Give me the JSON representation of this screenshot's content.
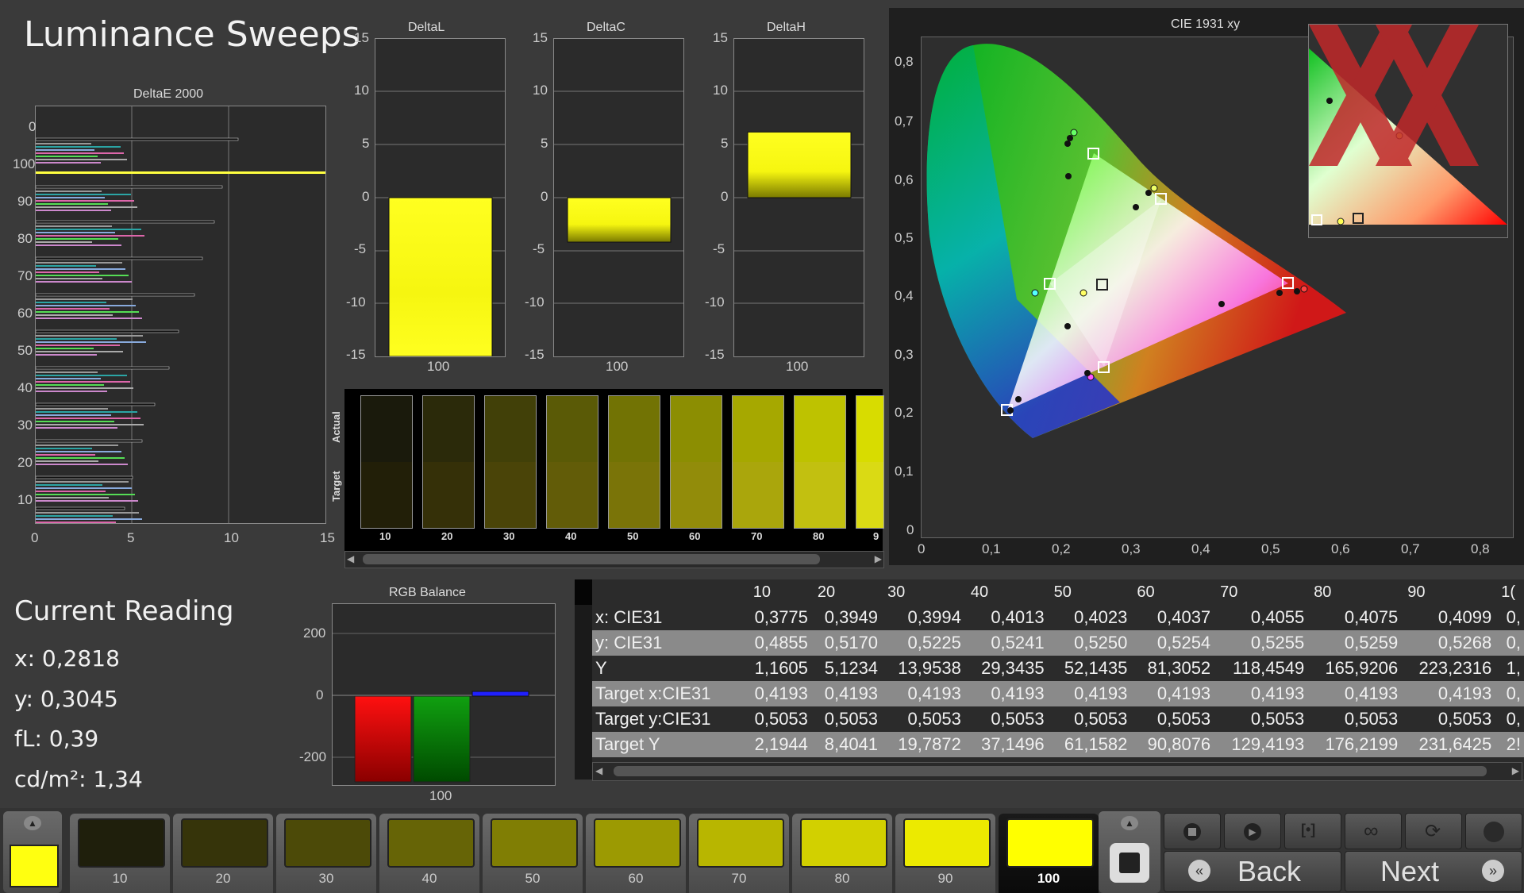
{
  "title": "Luminance Sweeps",
  "deltaE": {
    "title": "DeltaE 2000",
    "y_ticks": [
      "0",
      "100",
      "90",
      "80",
      "70",
      "60",
      "50",
      "40",
      "30",
      "20",
      "10"
    ],
    "x_ticks": [
      "0",
      "5",
      "10",
      "15"
    ]
  },
  "delta_charts": [
    {
      "title": "DeltaL",
      "xlabel": "100"
    },
    {
      "title": "DeltaC",
      "xlabel": "100"
    },
    {
      "title": "DeltaH",
      "xlabel": "100"
    }
  ],
  "delta_y_ticks": [
    "15",
    "10",
    "5",
    "0",
    "-5",
    "-10",
    "-15"
  ],
  "strip": {
    "actual_label": "Actual",
    "target_label": "Target",
    "steps": [
      {
        "label": "10",
        "actual": "#1a1a0c",
        "target": "#221f08"
      },
      {
        "label": "20",
        "actual": "#2b2a0a",
        "target": "#353008"
      },
      {
        "label": "30",
        "actual": "#414008",
        "target": "#4a4408"
      },
      {
        "label": "40",
        "actual": "#5a5a06",
        "target": "#625c08"
      },
      {
        "label": "50",
        "actual": "#727304",
        "target": "#7a7408"
      },
      {
        "label": "60",
        "actual": "#8c8e02",
        "target": "#928c0a"
      },
      {
        "label": "70",
        "actual": "#a6a800",
        "target": "#aaa60c"
      },
      {
        "label": "80",
        "actual": "#bec200",
        "target": "#c2c010"
      },
      {
        "label": "9",
        "actual": "#d8dc00",
        "target": "#dada14"
      }
    ]
  },
  "cie": {
    "title": "CIE 1931 xy",
    "x_ticks": [
      "0",
      "0,1",
      "0,2",
      "0,3",
      "0,4",
      "0,5",
      "0,6",
      "0,7",
      "0,8"
    ],
    "y_ticks": [
      "0,8",
      "0,7",
      "0,6",
      "0,5",
      "0,4",
      "0,3",
      "0,2",
      "0,1",
      "0"
    ]
  },
  "current_reading": {
    "title": "Current Reading",
    "x": "x: 0,2818",
    "y": "y: 0,3045",
    "fl": "fL: 0,39",
    "cd": "cd/m²: 1,34"
  },
  "rgb_balance": {
    "title": "RGB Balance",
    "y_ticks": [
      "200",
      "0",
      "-200"
    ],
    "xlabel": "100"
  },
  "table": {
    "columns": [
      "10",
      "20",
      "30",
      "40",
      "50",
      "60",
      "70",
      "80",
      "90",
      "1("
    ],
    "rows": [
      {
        "label": "x: CIE31",
        "values": [
          "0,3775",
          "0,3949",
          "0,3994",
          "0,4013",
          "0,4023",
          "0,4037",
          "0,4055",
          "0,4075",
          "0,4099",
          "0,"
        ]
      },
      {
        "label": "y: CIE31",
        "values": [
          "0,4855",
          "0,5170",
          "0,5225",
          "0,5241",
          "0,5250",
          "0,5254",
          "0,5255",
          "0,5259",
          "0,5268",
          "0,"
        ]
      },
      {
        "label": "Y",
        "values": [
          "1,1605",
          "5,1234",
          "13,9538",
          "29,3435",
          "52,1435",
          "81,3052",
          "118,4549",
          "165,9206",
          "223,2316",
          "1,"
        ]
      },
      {
        "label": "Target x:CIE31",
        "values": [
          "0,4193",
          "0,4193",
          "0,4193",
          "0,4193",
          "0,4193",
          "0,4193",
          "0,4193",
          "0,4193",
          "0,4193",
          "0,"
        ]
      },
      {
        "label": "Target y:CIE31",
        "values": [
          "0,5053",
          "0,5053",
          "0,5053",
          "0,5053",
          "0,5053",
          "0,5053",
          "0,5053",
          "0,5053",
          "0,5053",
          "0,"
        ]
      },
      {
        "label": "Target Y",
        "values": [
          "2,1944",
          "8,4041",
          "19,7872",
          "37,1496",
          "61,1582",
          "90,8076",
          "129,4193",
          "176,2199",
          "231,6425",
          "2!"
        ]
      }
    ]
  },
  "bottom": {
    "swatches": [
      {
        "label": "10",
        "color": "#1f1f0c"
      },
      {
        "label": "20",
        "color": "#36340a"
      },
      {
        "label": "30",
        "color": "#4c4a08"
      },
      {
        "label": "40",
        "color": "#666406"
      },
      {
        "label": "50",
        "color": "#807e04"
      },
      {
        "label": "60",
        "color": "#9c9a02"
      },
      {
        "label": "70",
        "color": "#b8b600"
      },
      {
        "label": "80",
        "color": "#d2d000"
      },
      {
        "label": "90",
        "color": "#ecea00"
      },
      {
        "label": "100",
        "color": "#ffff00"
      }
    ],
    "back_label": "Back",
    "next_label": "Next"
  },
  "chart_data": [
    {
      "type": "bar",
      "title": "DeltaE 2000",
      "categories": [
        "100"
      ],
      "series": [],
      "xlim": [
        0,
        15
      ]
    },
    {
      "type": "bar",
      "title": "DeltaL",
      "categories": [
        "100"
      ],
      "values": [
        -15
      ],
      "ylim": [
        -15,
        15
      ]
    },
    {
      "type": "bar",
      "title": "DeltaC",
      "categories": [
        "100"
      ],
      "values": [
        -4.2
      ],
      "ylim": [
        -15,
        15
      ]
    },
    {
      "type": "bar",
      "title": "DeltaH",
      "categories": [
        "100"
      ],
      "values": [
        6.2
      ],
      "ylim": [
        -15,
        15
      ]
    },
    {
      "type": "bar",
      "title": "RGB Balance",
      "categories": [
        "100"
      ],
      "values": [
        -285,
        -285,
        5
      ],
      "colors": [
        "#ff0000",
        "#00a000",
        "#2020ff"
      ],
      "ylim": [
        -300,
        300
      ]
    }
  ],
  "colors": {
    "yellow": "#ffff1a",
    "accent_red": "#c0282a"
  }
}
